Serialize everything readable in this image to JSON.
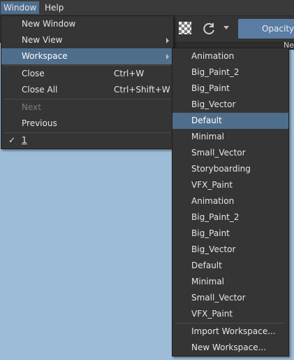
{
  "menubar": {
    "window": "Window",
    "help": "Help"
  },
  "toolbar": {
    "opacity_label": "Opacity:",
    "tab_label": "Ne"
  },
  "window_menu": {
    "items": [
      {
        "label": "New Window",
        "shortcut": ""
      },
      {
        "label": "New View",
        "shortcut": ""
      },
      {
        "label": "Workspace",
        "shortcut": ""
      },
      {
        "label": "Close",
        "shortcut": "Ctrl+W"
      },
      {
        "label": "Close All",
        "shortcut": "Ctrl+Shift+W"
      },
      {
        "label": "Next",
        "shortcut": ""
      },
      {
        "label": "Previous",
        "shortcut": ""
      },
      {
        "label": "1",
        "shortcut": ""
      }
    ],
    "check_mark": "✓"
  },
  "workspace_menu": {
    "items": [
      "Animation",
      "Big_Paint_2",
      "Big_Paint",
      "Big_Vector",
      "Default",
      "Minimal",
      "Small_Vector",
      "Storyboarding",
      "VFX_Paint",
      "Animation",
      "Big_Paint_2",
      "Big_Paint",
      "Big_Vector",
      "Default",
      "Minimal",
      "Small_Vector",
      "VFX_Paint",
      "Import Workspace...",
      "New Workspace..."
    ]
  },
  "icons": {
    "checker": "transparency-checker-icon",
    "reset": "reset-rotate-icon",
    "caret": "chevron-down-icon",
    "submenu": "chevron-right-icon"
  },
  "colors": {
    "menu_bg": "#353535",
    "highlight": "#4f6e8c",
    "canvas": "#9dbcd8",
    "opacity_field": "#5a7ea3",
    "disabled_text": "#7c7c7c"
  }
}
